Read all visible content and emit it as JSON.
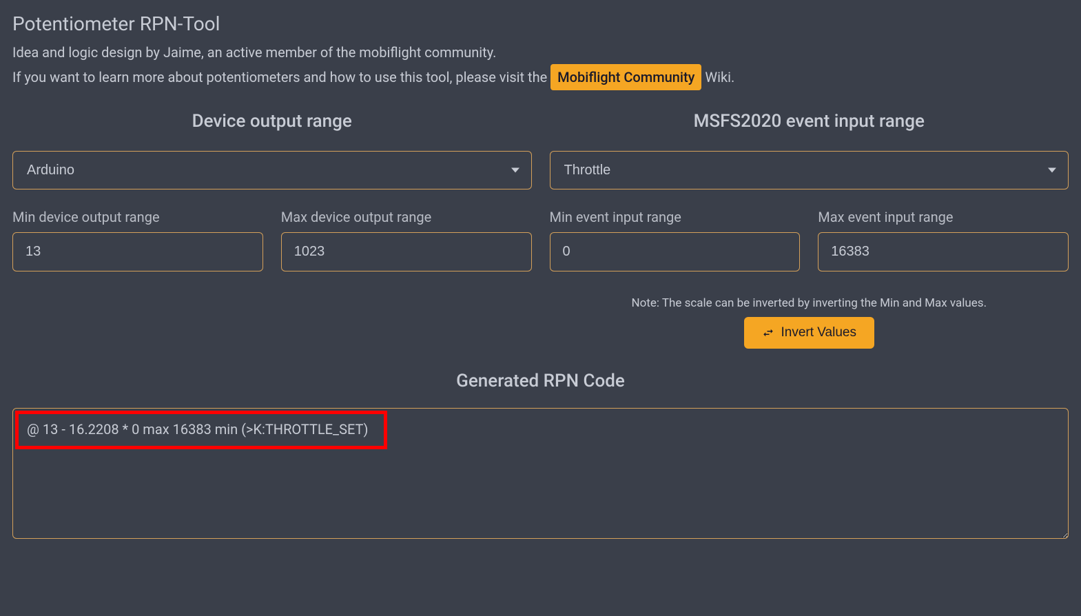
{
  "header": {
    "title": "Potentiometer RPN-Tool",
    "line1": "Idea and logic design by Jaime, an active member of the mobiflight community.",
    "line2_pre": "If you want to learn more about potentiometers and how to use this tool, please visit the ",
    "link_label": "Mobiflight Community",
    "line2_post": " Wiki."
  },
  "left": {
    "heading": "Device output range",
    "select_value": "Arduino",
    "min_label": "Min device output range",
    "min_value": "13",
    "max_label": "Max device output range",
    "max_value": "1023"
  },
  "right": {
    "heading": "MSFS2020 event input range",
    "select_value": "Throttle",
    "min_label": "Min event input range",
    "min_value": "0",
    "max_label": "Max event input range",
    "max_value": "16383",
    "note": "Note: The scale can be inverted by inverting the Min and Max values.",
    "invert_label": "Invert Values"
  },
  "output": {
    "heading": "Generated RPN Code",
    "code": "@ 13 - 16.2208 * 0 max 16383 min (>K:THROTTLE_SET)"
  }
}
